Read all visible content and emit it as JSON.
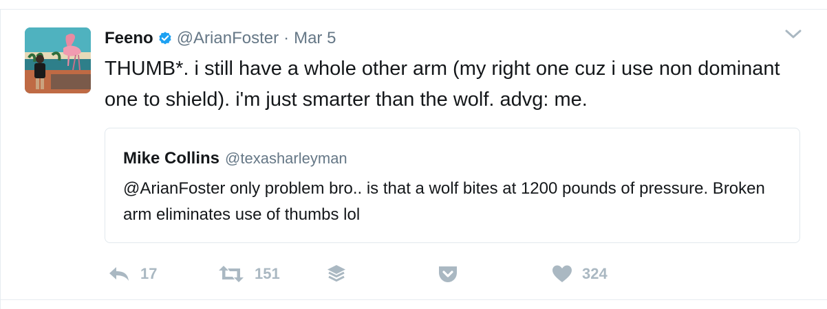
{
  "tweet": {
    "author_name": "Feeno",
    "author_handle": "@ArianFoster",
    "separator": "·",
    "timestamp": "Mar 5",
    "text": "THUMB*. i still have a whole other arm (my right one cuz i use non dominant one to shield). i'm just smarter than the wolf. advg: me.",
    "verified": true
  },
  "quote": {
    "author_name": "Mike Collins",
    "author_handle": "@texasharleyman",
    "text": "@ArianFoster only problem bro.. is that a wolf bites at 1200 pounds of pressure.  Broken arm eliminates use of thumbs lol"
  },
  "actions": {
    "reply_count": "17",
    "retweet_count": "151",
    "like_count": "324"
  },
  "icons": {
    "verified": "verified-badge-icon",
    "more": "chevron-down-icon",
    "reply": "reply-icon",
    "retweet": "retweet-icon",
    "buffer": "buffer-stack-icon",
    "pocket": "pocket-icon",
    "like": "heart-icon"
  },
  "colors": {
    "verified_blue": "#1da1f2",
    "muted_text": "#657786",
    "action_gray": "#aab8c2",
    "border": "#e1e8ed"
  }
}
